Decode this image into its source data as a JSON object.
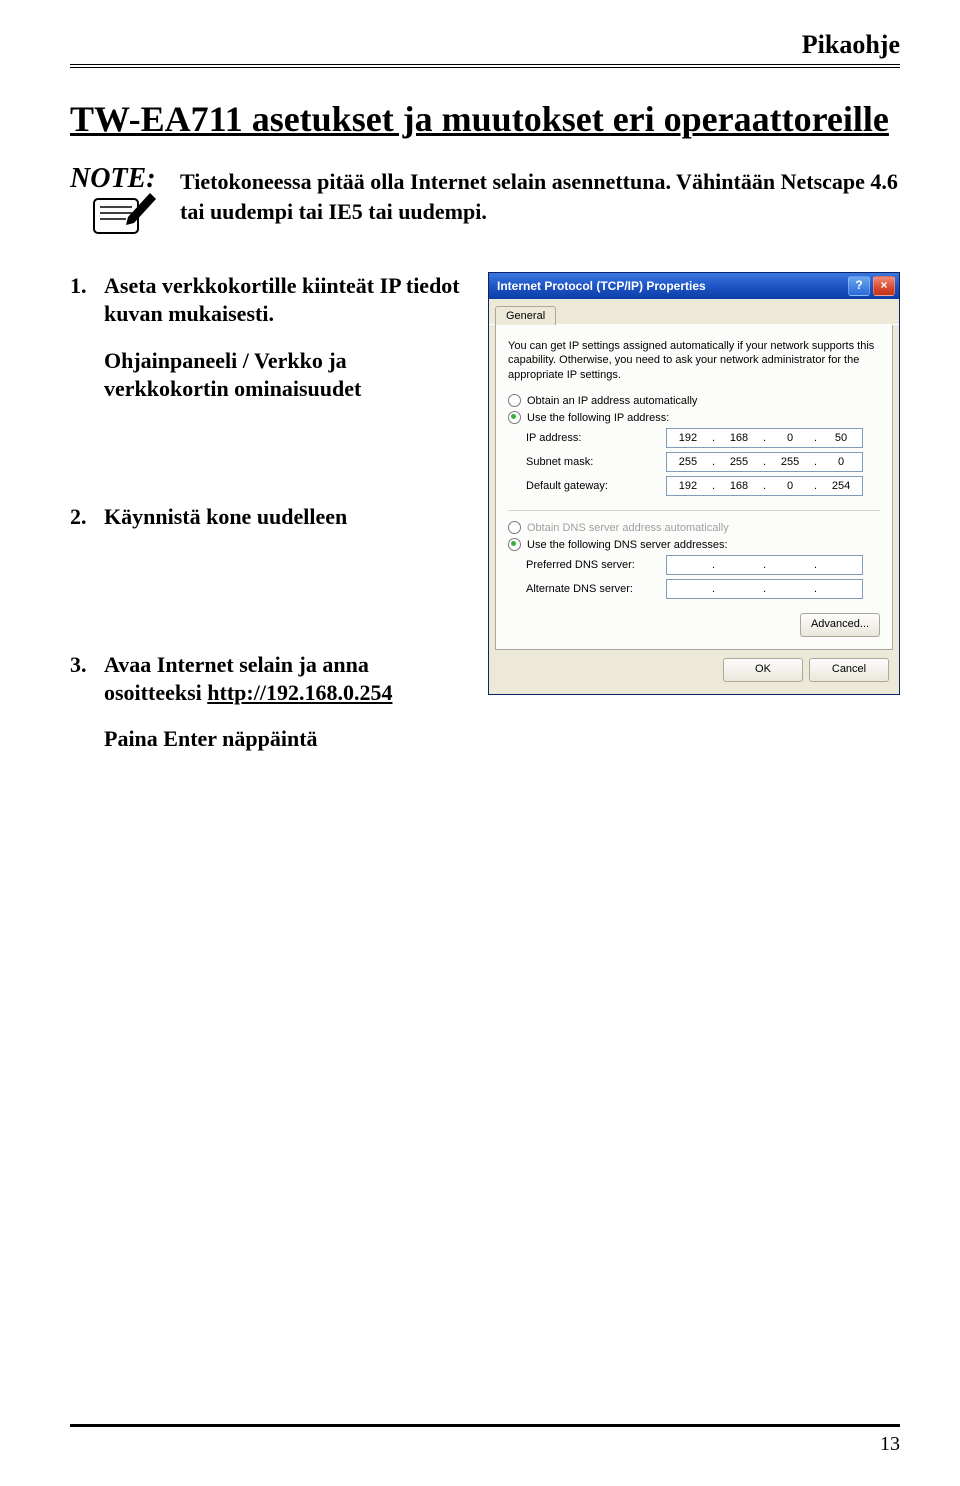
{
  "header": {
    "label": "Pikaohje"
  },
  "title": "TW-EA711 asetukset ja muutokset eri operaattoreille",
  "note": {
    "label": "NOTE:",
    "text": "Tietokoneessa pitää olla Internet selain asennettuna. Vähintään Netscape 4.6 tai uudempi tai IE5 tai uudempi."
  },
  "steps": [
    {
      "n": "1.",
      "body": "Aseta verkkokortille kiinteät IP tiedot kuvan mukaisesti.",
      "sub": "Ohjainpaneeli / Verkko ja verkkokortin ominaisuudet"
    },
    {
      "n": "2.",
      "body": "Käynnistä kone uudelleen"
    },
    {
      "n": "3.",
      "body": "Avaa Internet selain ja anna osoitteeksi",
      "link": "http://192.168.0.254",
      "after": "Paina Enter näppäintä"
    }
  ],
  "dialog": {
    "title": "Internet Protocol (TCP/IP) Properties",
    "tab": "General",
    "intro": "You can get IP settings assigned automatically if your network supports this capability. Otherwise, you need to ask your network administrator for the appropriate IP settings.",
    "radio_auto_ip": "Obtain an IP address automatically",
    "radio_use_ip": "Use the following IP address:",
    "fields": {
      "ip_label": "IP address:",
      "ip_value": [
        "192",
        "168",
        "0",
        "50"
      ],
      "mask_label": "Subnet mask:",
      "mask_value": [
        "255",
        "255",
        "255",
        "0"
      ],
      "gw_label": "Default gateway:",
      "gw_value": [
        "192",
        "168",
        "0",
        "254"
      ]
    },
    "radio_auto_dns": "Obtain DNS server address automatically",
    "radio_use_dns": "Use the following DNS server addresses:",
    "dns": {
      "pref_label": "Preferred DNS server:",
      "alt_label": "Alternate DNS server:"
    },
    "advanced": "Advanced...",
    "ok": "OK",
    "cancel": "Cancel"
  },
  "page_number": "13"
}
